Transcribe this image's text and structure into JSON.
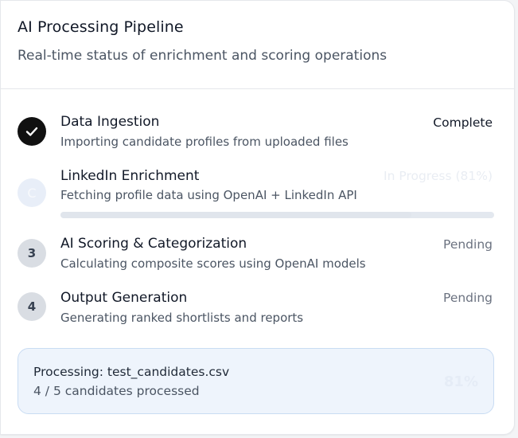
{
  "header": {
    "title": "AI Processing Pipeline",
    "subtitle": "Real-time status of enrichment and scoring operations"
  },
  "steps": [
    {
      "title": "Data Ingestion",
      "description": "Importing candidate profiles from uploaded files",
      "status": "Complete",
      "state": "complete",
      "icon": "check-icon"
    },
    {
      "title": "LinkedIn Enrichment",
      "description": "Fetching profile data using OpenAI + LinkedIn API",
      "status": "In Progress (81%)",
      "state": "in-progress",
      "indicator": "C",
      "progress_percent": 81
    },
    {
      "number": "3",
      "title": "AI Scoring & Categorization",
      "description": "Calculating composite scores using OpenAI models",
      "status": "Pending",
      "state": "pending"
    },
    {
      "number": "4",
      "title": "Output Generation",
      "description": "Generating ranked shortlists and reports",
      "status": "Pending",
      "state": "pending"
    }
  ],
  "processing": {
    "file_label": "Processing: test_candidates.csv",
    "count_label": "4 / 5 candidates processed",
    "percent": "81%"
  },
  "colors": {
    "complete": "#111111",
    "pending_circle": "#d9dde3",
    "box_background": "#eef4fc",
    "box_border": "#c9dcf3"
  }
}
